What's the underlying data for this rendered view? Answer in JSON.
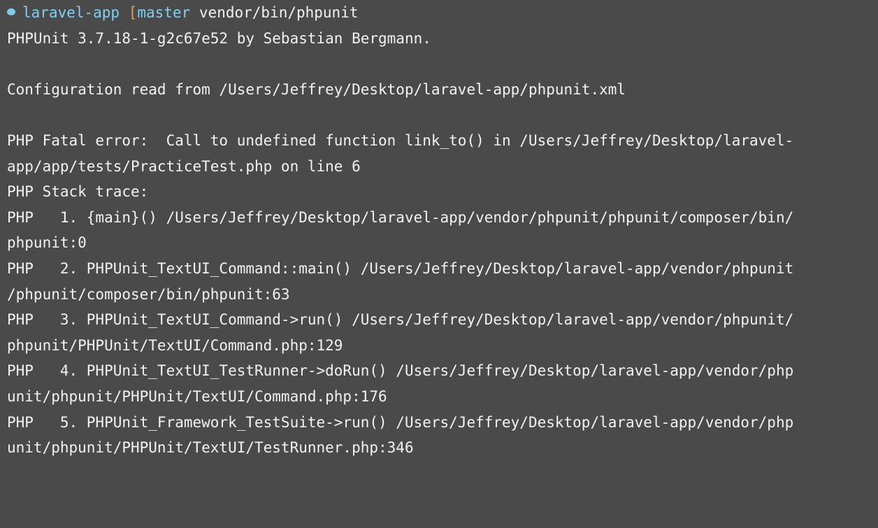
{
  "prompt": {
    "dir": "laravel-app",
    "branch_open": "[",
    "branch": "master",
    "command": "vendor/bin/phpunit",
    "colors": {
      "dir": "#82cff0",
      "bracket": "#e0a25a",
      "dot": "#7ecbe8"
    }
  },
  "output": {
    "line1": "PHPUnit 3.7.18-1-g2c67e52 by Sebastian Bergmann.",
    "line2": "Configuration read from /Users/Jeffrey/Desktop/laravel-app/phpunit.xml",
    "line3": "PHP Fatal error:  Call to undefined function link_to() in /Users/Jeffrey/Desktop/laravel-",
    "line4": "app/app/tests/PracticeTest.php on line 6",
    "line5": "PHP Stack trace:",
    "line6": "PHP   1. {main}() /Users/Jeffrey/Desktop/laravel-app/vendor/phpunit/phpunit/composer/bin/",
    "line7": "phpunit:0",
    "line8": "PHP   2. PHPUnit_TextUI_Command::main() /Users/Jeffrey/Desktop/laravel-app/vendor/phpunit",
    "line9": "/phpunit/composer/bin/phpunit:63",
    "line10": "PHP   3. PHPUnit_TextUI_Command->run() /Users/Jeffrey/Desktop/laravel-app/vendor/phpunit/",
    "line11": "phpunit/PHPUnit/TextUI/Command.php:129",
    "line12": "PHP   4. PHPUnit_TextUI_TestRunner->doRun() /Users/Jeffrey/Desktop/laravel-app/vendor/php",
    "line13": "unit/phpunit/PHPUnit/TextUI/Command.php:176",
    "line14": "PHP   5. PHPUnit_Framework_TestSuite->run() /Users/Jeffrey/Desktop/laravel-app/vendor/php",
    "line15": "unit/phpunit/PHPUnit/TextUI/TestRunner.php:346"
  },
  "theme": {
    "background": "#4a4a4a",
    "foreground": "#f2f2f2"
  }
}
